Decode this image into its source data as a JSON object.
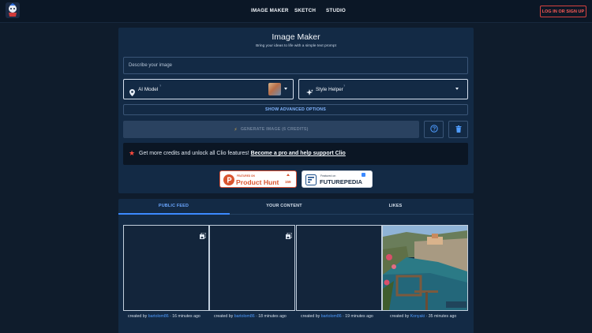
{
  "topbar": {
    "nav": [
      "IMAGE MAKER",
      "SKETCH",
      "STUDIO"
    ],
    "login_label": "LOG IN OR SIGN UP"
  },
  "maker": {
    "title": "Image Maker",
    "subtitle": "Bring your ideas to life with a simple text prompt",
    "prompt_placeholder": "Describe your image",
    "model_label": "AI Model",
    "style_label": "Style Helper",
    "help_mark": "?",
    "advanced_label": "SHOW ADVANCED OPTIONS",
    "generate_label": "GENERATE IMAGE (6 CREDITS)",
    "promo_text": "Get more credits and unlock all Clio features!",
    "promo_link": "Become a pro and help support Clio",
    "badges": {
      "producthunt_top": "FEATURED ON",
      "producthunt_name": "Product Hunt",
      "producthunt_count": "159",
      "futurepedia_top": "Featured on",
      "futurepedia_name": "FUTUREPEDIA"
    }
  },
  "feed": {
    "tabs": [
      "PUBLIC FEED",
      "YOUR CONTENT",
      "LIKES"
    ],
    "active_tab": "PUBLIC FEED",
    "items": [
      {
        "prefix": "created by",
        "user": "bartolom86",
        "time": "· 16 minutes ago"
      },
      {
        "prefix": "created by",
        "user": "bartolom86",
        "time": "· 18 minutes ago"
      },
      {
        "prefix": "created by",
        "user": "bartolom86",
        "time": "· 19 minutes ago"
      },
      {
        "prefix": "created by",
        "user": "Konyaki",
        "time": "· 35 minutes ago"
      }
    ]
  },
  "colors": {
    "background": "#0f1c2c",
    "panel": "#132a45",
    "accent": "#3c8aff",
    "danger": "#d6423f"
  },
  "icons": [
    "app-logo-icon",
    "location-pin-icon",
    "sparkle-icon",
    "chevron-down-icon",
    "bolt-icon",
    "help-circle-icon",
    "trash-icon",
    "star-icon",
    "image-stack-icon"
  ]
}
